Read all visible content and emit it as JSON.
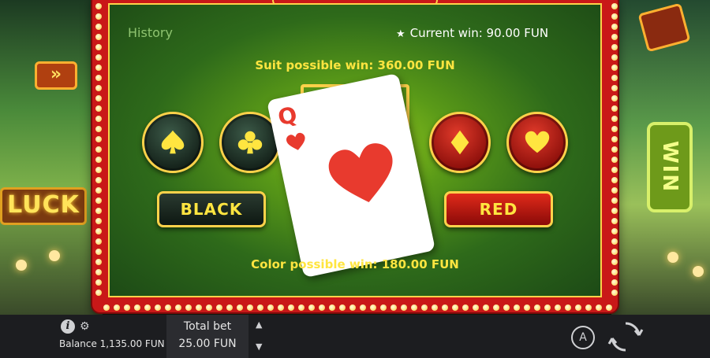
{
  "header": {
    "history_label": "History",
    "current_win_label": "Current win: 90.00 FUN"
  },
  "game": {
    "suit_possible_win": "Suit possible win: 360.00 FUN",
    "color_possible_win": "Color possible win: 180.00 FUN",
    "suits": [
      {
        "name": "spade-icon",
        "color": "black"
      },
      {
        "name": "club-icon",
        "color": "black"
      },
      {
        "name": "diamond-icon",
        "color": "red"
      },
      {
        "name": "heart-icon",
        "color": "red"
      }
    ],
    "black_button_label": "BLACK",
    "red_button_label": "RED",
    "card": {
      "rank": "Q",
      "suit": "heart",
      "suit_color": "#e83a2e"
    }
  },
  "background": {
    "left_sign": "LUCK",
    "right_sign": "WIN",
    "arrow_sign": "»"
  },
  "footer": {
    "balance_label": "Balance 1,135.00 FUN",
    "total_bet_label": "Total bet",
    "total_bet_value": "25.00 FUN",
    "bet_up_icon": "▲",
    "bet_down_icon": "▼",
    "auto_label": "A"
  },
  "colors": {
    "frame_red": "#c91818",
    "gold": "#ffd24a",
    "text_yellow": "#ffe540",
    "history_green": "#8fc470"
  }
}
